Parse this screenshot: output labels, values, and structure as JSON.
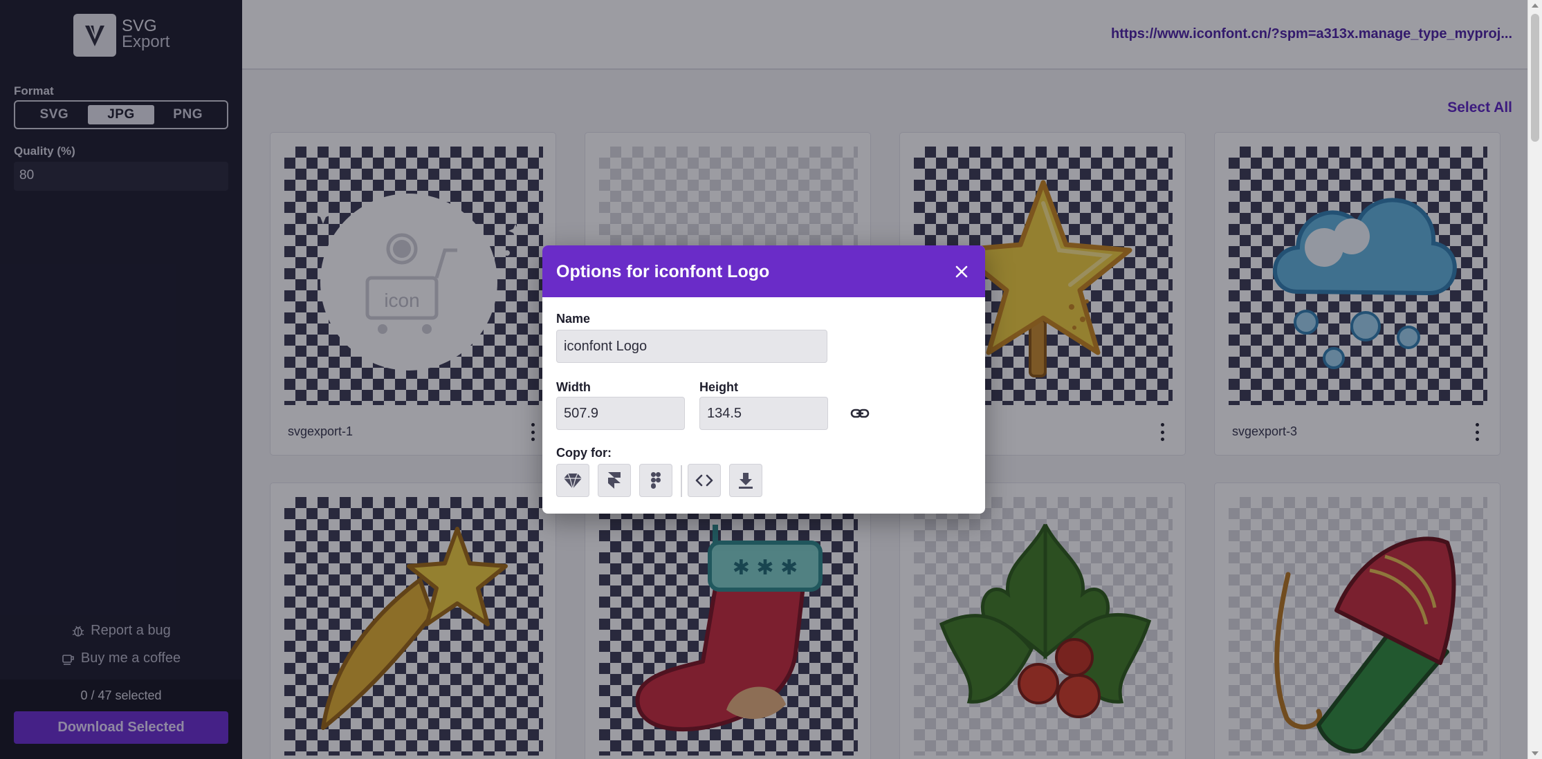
{
  "sidebar": {
    "logo": {
      "line1": "SVG",
      "line2": "Export"
    },
    "format_label": "Format",
    "formats": [
      {
        "label": "SVG",
        "active": false
      },
      {
        "label": "JPG",
        "active": true
      },
      {
        "label": "PNG",
        "active": false
      }
    ],
    "quality_label": "Quality (%)",
    "quality_value": "80",
    "report_bug": "Report a bug",
    "buy_coffee": "Buy me a coffee",
    "selected_count": "0 / 47 selected",
    "download_selected": "Download Selected"
  },
  "header": {
    "url": "https://www.iconfont.cn/?spm=a313x.manage_type_myproj..."
  },
  "main": {
    "select_all": "Select All",
    "cards": [
      {
        "name": "svgexport-1",
        "icon": "iconfont-logo-icon"
      },
      {
        "name": "",
        "icon": "blank-icon"
      },
      {
        "name": "",
        "icon": "christmas-star-icon"
      },
      {
        "name": "svgexport-3",
        "icon": "snow-cloud-icon"
      },
      {
        "name": "",
        "icon": "shooting-star-icon"
      },
      {
        "name": "",
        "icon": "christmas-stocking-icon"
      },
      {
        "name": "",
        "icon": "holly-berries-icon"
      },
      {
        "name": "",
        "icon": "firework-rocket-icon"
      }
    ]
  },
  "modal": {
    "title": "Options for iconfont Logo",
    "name_label": "Name",
    "name_value": "iconfont Logo",
    "width_label": "Width",
    "width_value": "507.9",
    "height_label": "Height",
    "height_value": "134.5",
    "copy_for_label": "Copy for:",
    "copy_buttons": [
      "sketch-icon",
      "framer-icon",
      "figma-icon",
      "code-icon",
      "download-icon"
    ]
  },
  "colors": {
    "accent": "#6a2cc8",
    "sidebar_bg": "#1a1a2a",
    "link": "#4b1fa3"
  }
}
